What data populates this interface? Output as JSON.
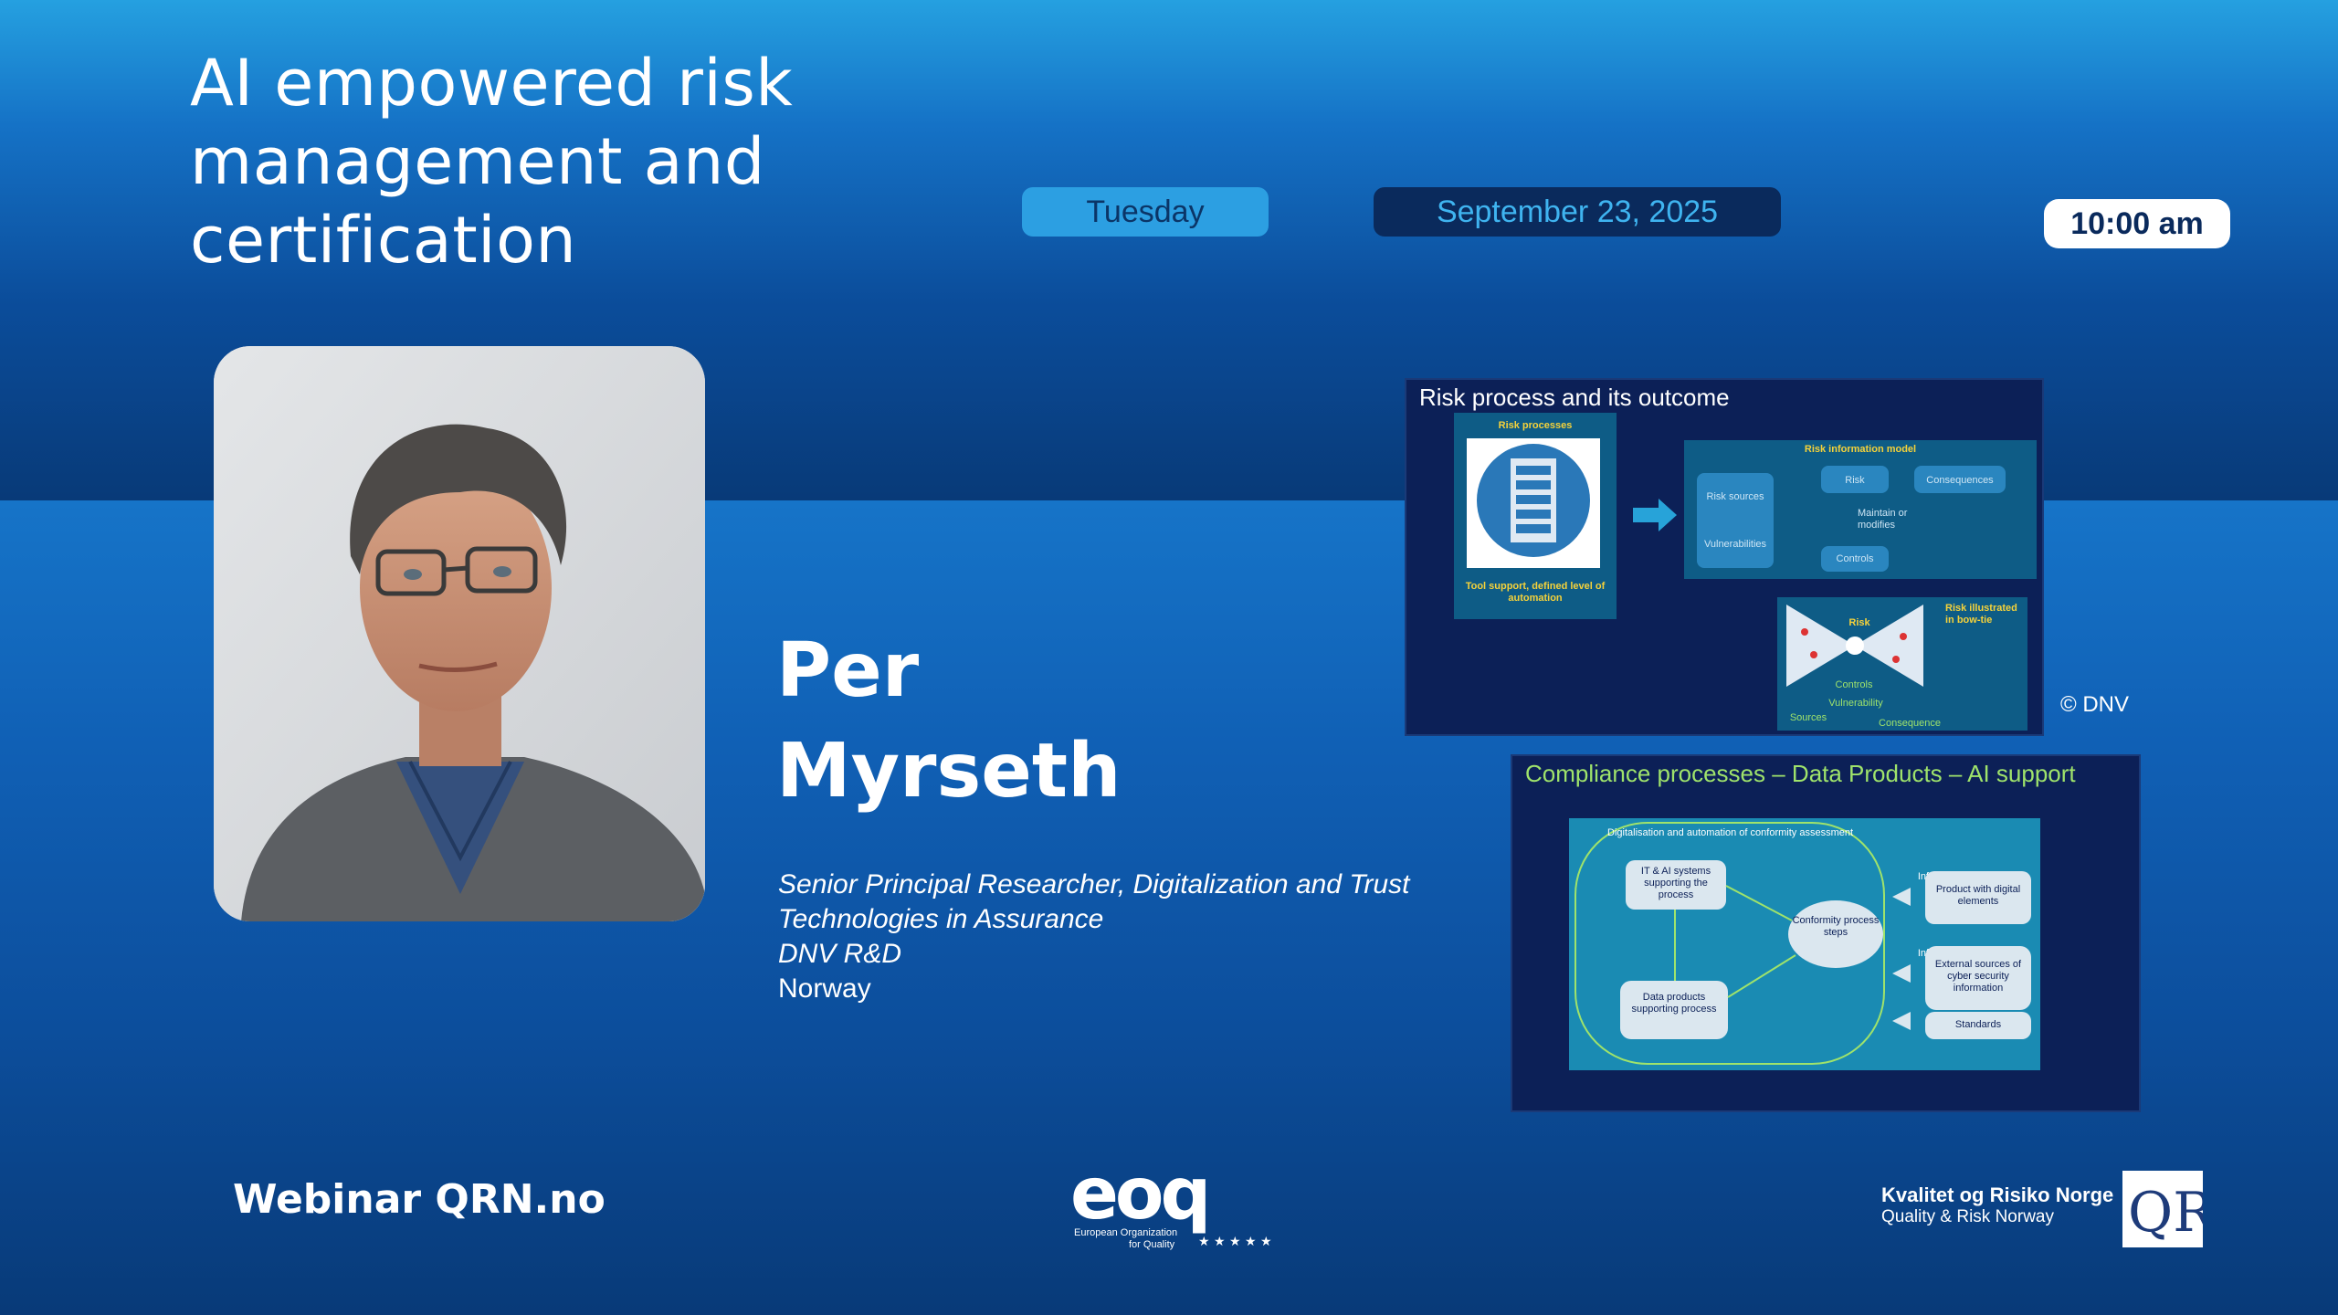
{
  "event": {
    "title_lines": [
      "AI empowered risk",
      "management and",
      "certification"
    ],
    "day": "Tuesday",
    "date": "September 23, 2025",
    "time": "10:00 am"
  },
  "speaker": {
    "first_name": "Per",
    "last_name": "Myrseth",
    "role_lines": [
      "Senior Principal Researcher, Digitalization and  Trust",
      "Technologies in Assurance",
      "DNV R&D"
    ],
    "country": "Norway"
  },
  "slides": {
    "slide1": {
      "title": "Risk process and its outcome",
      "labels": {
        "risk_processes": "Risk processes",
        "tool_support": "Tool support, defined level of automation",
        "risk_info_model": "Risk information model",
        "risk_sources": "Risk sources",
        "vulnerabilities": "Vulnerabilities",
        "risk": "Risk",
        "consequences": "Consequences",
        "maintain": "Maintain or modifies",
        "controls": "Controls",
        "risk_bowtie": "Risk illustrated in bow-tie",
        "bow_risk": "Risk",
        "bow_controls": "Controls",
        "bow_vulnerability": "Vulnerability",
        "bow_sources": "Sources",
        "bow_consequence": "Consequence"
      }
    },
    "copyright": "© DNV",
    "slide2": {
      "title": "Compliance processes – Data Products – AI support",
      "labels": {
        "frame": "Digitalisation and automation of conformity assessment",
        "it_ai": "IT & AI systems supporting the process",
        "conformity": "Conformity process steps",
        "data_products": "Data products supporting process",
        "info1": "Info",
        "info2": "Info",
        "product": "Product with digital elements",
        "external": "External sources of cyber security information",
        "standards": "Standards"
      }
    }
  },
  "footer": {
    "webinar": "Webinar  QRN.no",
    "eoq_word": "eoq",
    "eoq_sub_1": "European Organization",
    "eoq_sub_2": "for Quality",
    "qrn_name": "Kvalitet og Risiko Norge",
    "qrn_sub": "Quality & Risk Norway",
    "qrn_logo": "QR"
  },
  "colors": {
    "accent_light": "#2c9fe2",
    "accent_dark": "#0a2a5c",
    "slide_green": "#9fe36b"
  }
}
